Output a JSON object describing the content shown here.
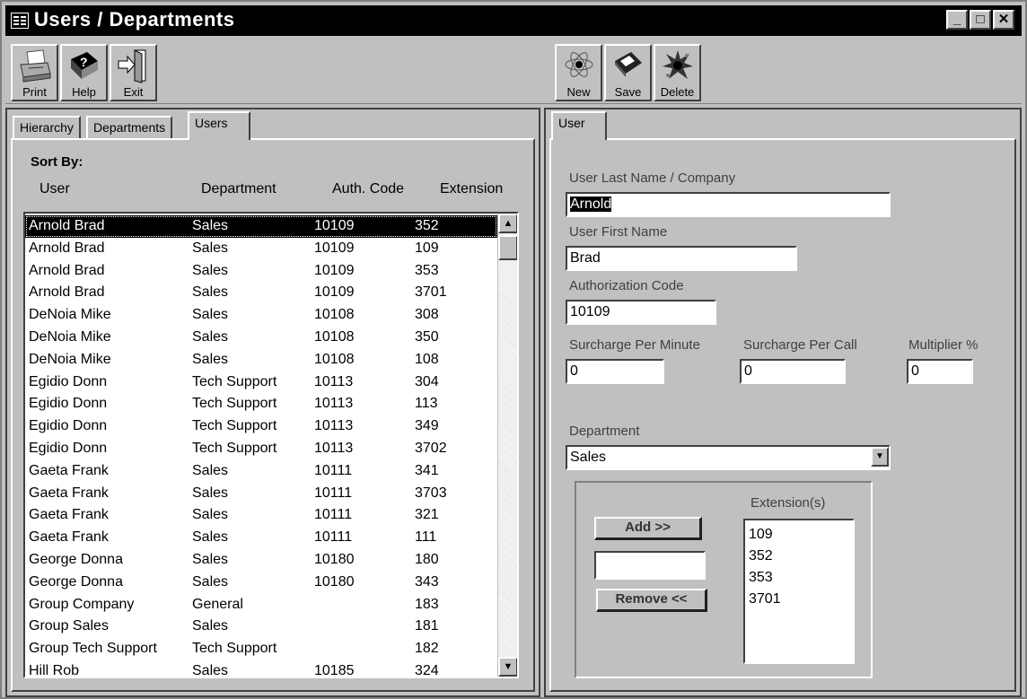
{
  "window": {
    "title": "Users / Departments",
    "controls": [
      "_",
      "□",
      "✕"
    ]
  },
  "toolbar_left": [
    {
      "label": "Print",
      "icon": "printer-icon"
    },
    {
      "label": "Help",
      "icon": "help-book-icon"
    },
    {
      "label": "Exit",
      "icon": "exit-door-icon"
    }
  ],
  "toolbar_right": [
    {
      "label": "New",
      "icon": "atom-new-icon"
    },
    {
      "label": "Save",
      "icon": "floppy-disk-icon"
    },
    {
      "label": "Delete",
      "icon": "explode-delete-icon"
    }
  ],
  "left_panel": {
    "tabs": [
      "Hierarchy",
      "Departments",
      "Users"
    ],
    "active_tab": "Users",
    "sort_by_label": "Sort By:",
    "columns": [
      "User",
      "Department",
      "Auth. Code",
      "Extension"
    ],
    "rows": [
      [
        "Arnold Brad",
        "Sales",
        "10109",
        "352"
      ],
      [
        "Arnold Brad",
        "Sales",
        "10109",
        "109"
      ],
      [
        "Arnold Brad",
        "Sales",
        "10109",
        "353"
      ],
      [
        "Arnold Brad",
        "Sales",
        "10109",
        "3701"
      ],
      [
        "DeNoia Mike",
        "Sales",
        "10108",
        "308"
      ],
      [
        "DeNoia Mike",
        "Sales",
        "10108",
        "350"
      ],
      [
        "DeNoia Mike",
        "Sales",
        "10108",
        "108"
      ],
      [
        "Egidio Donn",
        "Tech Support",
        "10113",
        "304"
      ],
      [
        "Egidio Donn",
        "Tech Support",
        "10113",
        "113"
      ],
      [
        "Egidio Donn",
        "Tech Support",
        "10113",
        "349"
      ],
      [
        "Egidio Donn",
        "Tech Support",
        "10113",
        "3702"
      ],
      [
        "Gaeta Frank",
        "Sales",
        "10111",
        "341"
      ],
      [
        "Gaeta Frank",
        "Sales",
        "10111",
        "3703"
      ],
      [
        "Gaeta Frank",
        "Sales",
        "10111",
        "321"
      ],
      [
        "Gaeta Frank",
        "Sales",
        "10111",
        "111"
      ],
      [
        "George Donna",
        "Sales",
        "10180",
        "180"
      ],
      [
        "George Donna",
        "Sales",
        "10180",
        "343"
      ],
      [
        "Group Company",
        "General",
        "",
        "183"
      ],
      [
        "Group Sales",
        "Sales",
        "",
        "181"
      ],
      [
        "Group Tech Support",
        "Tech Support",
        "",
        "182"
      ],
      [
        "Hill Rob",
        "Sales",
        "10185",
        "324"
      ]
    ],
    "selected_index": 0
  },
  "right_panel": {
    "tab": "User",
    "last_name_label": "User Last Name / Company",
    "last_name_value": "Arnold",
    "first_name_label": "User First Name",
    "first_name_value": "Brad",
    "auth_code_label": "Authorization Code",
    "auth_code_value": "10109",
    "surcharge_min_label": "Surcharge Per Minute",
    "surcharge_min_value": "0",
    "surcharge_call_label": "Surcharge Per Call",
    "surcharge_call_value": "0",
    "multiplier_label": "Multiplier %",
    "multiplier_value": "0",
    "department_label": "Department",
    "department_value": "Sales",
    "add_button": "Add  >>",
    "remove_button": "Remove  <<",
    "extension_input_value": "",
    "extensions_label": "Extension(s)",
    "extensions": [
      "109",
      "352",
      "353",
      "3701"
    ]
  }
}
